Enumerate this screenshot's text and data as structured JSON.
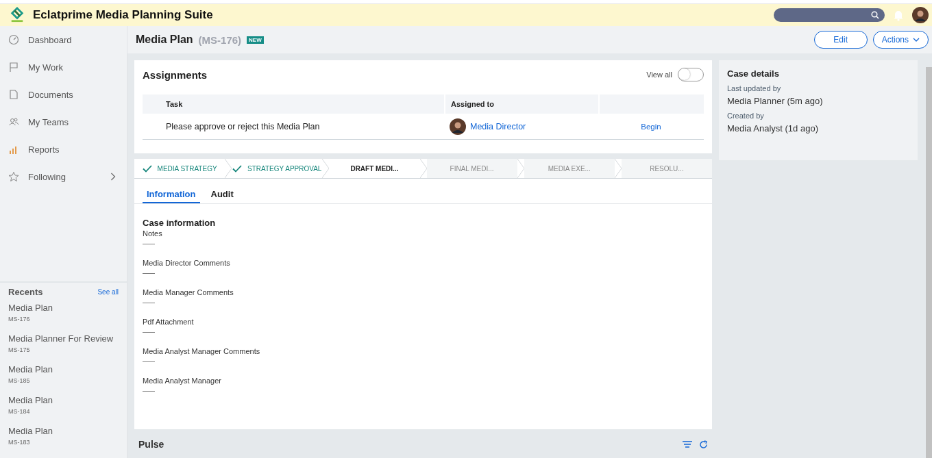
{
  "app": {
    "title": "Eclatprime Media Planning Suite"
  },
  "sidebar": {
    "items": [
      {
        "label": "Dashboard",
        "kind": "dashboard",
        "expandable": false
      },
      {
        "label": "My Work",
        "kind": "flag",
        "expandable": false
      },
      {
        "label": "Documents",
        "kind": "document",
        "expandable": false
      },
      {
        "label": "My Teams",
        "kind": "people",
        "expandable": false
      },
      {
        "label": "Reports",
        "kind": "chart",
        "expandable": false
      },
      {
        "label": "Following",
        "kind": "star",
        "expandable": true
      }
    ],
    "recents": {
      "title": "Recents",
      "see_all": "See all",
      "items": [
        {
          "title": "Media Plan",
          "id": "MS-176"
        },
        {
          "title": "Media Planner For Review",
          "id": "MS-175"
        },
        {
          "title": "Media Plan",
          "id": "MS-185"
        },
        {
          "title": "Media Plan",
          "id": "MS-184"
        },
        {
          "title": "Media Plan",
          "id": "MS-183"
        }
      ]
    }
  },
  "case": {
    "title": "Media Plan",
    "id": "(MS-176)",
    "badge": "NEW",
    "buttons": [
      {
        "label": "Edit",
        "dropdown": false
      },
      {
        "label": "Actions",
        "dropdown": true
      }
    ]
  },
  "assignments": {
    "title": "Assignments",
    "view_all": {
      "label": "View all",
      "on": false
    },
    "columns": [
      "Task",
      "Assigned to"
    ],
    "rows": [
      {
        "task": "Please approve or reject this Media Plan",
        "assignee": "Media Director",
        "action": "Begin"
      }
    ]
  },
  "stages": [
    {
      "label": "MEDIA STRATEGY",
      "done": true,
      "current": false
    },
    {
      "label": "STRATEGY APPROVAL",
      "done": true,
      "current": false
    },
    {
      "label": "DRAFT MEDI...",
      "done": false,
      "current": true
    },
    {
      "label": "FINAL MEDI...",
      "done": false,
      "current": false
    },
    {
      "label": "MEDIA EXE...",
      "done": false,
      "current": false
    },
    {
      "label": "RESOLU...",
      "done": false,
      "current": false
    }
  ],
  "tabs": [
    {
      "label": "Information",
      "selected": true
    },
    {
      "label": "Audit",
      "selected": false
    }
  ],
  "case_information": {
    "title": "Case information",
    "fields": [
      {
        "label": "Notes",
        "value": "——"
      },
      {
        "label": "Media Director Comments",
        "value": "——"
      },
      {
        "label": "Media Manager Comments",
        "value": "——"
      },
      {
        "label": "Pdf Attachment",
        "value": "——"
      },
      {
        "label": "Media Analyst Manager Comments",
        "value": "——"
      },
      {
        "label": "Media Analyst Manager",
        "value": "——"
      }
    ]
  },
  "pulse": {
    "title": "Pulse"
  },
  "case_details": {
    "title": "Case details",
    "fields": [
      {
        "label": "Last updated by",
        "value": "Media Planner (5m ago)"
      },
      {
        "label": "Created by",
        "value": "Media Analyst (1d ago)"
      }
    ]
  }
}
